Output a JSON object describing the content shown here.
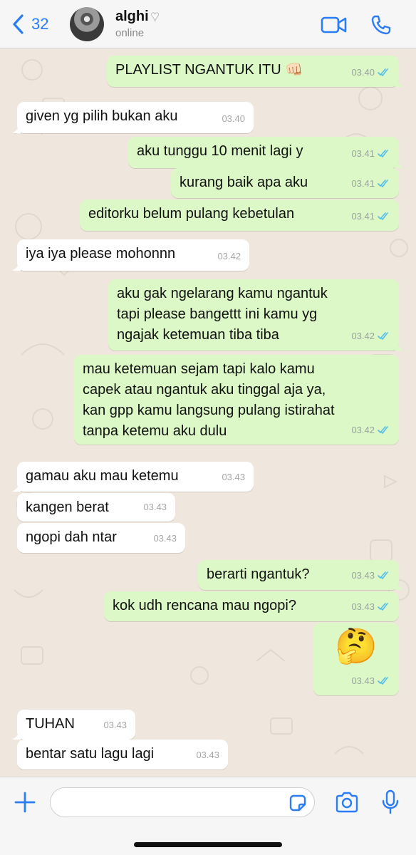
{
  "header": {
    "back_count": "32",
    "contact_name": "alghi",
    "contact_status": "online"
  },
  "messages": [
    {
      "dir": "out",
      "text": "PLAYLIST NGANTUK ITU 👊🏻",
      "time": "03.40"
    },
    {
      "dir": "in",
      "text": "given yg pilih bukan aku",
      "time": "03.40"
    },
    {
      "dir": "out",
      "text": "aku tunggu 10 menit lagi y",
      "time": "03.41"
    },
    {
      "dir": "out",
      "text": "kurang baik apa aku",
      "time": "03.41"
    },
    {
      "dir": "out",
      "text": "editorku belum pulang kebetulan",
      "time": "03.41"
    },
    {
      "dir": "in",
      "text": "iya iya please mohonnn",
      "time": "03.42"
    },
    {
      "dir": "out",
      "text": "aku gak ngelarang kamu ngantuk tapi please bangettt ini kamu yg ngajak ketemuan tiba tiba",
      "time": "03.42"
    },
    {
      "dir": "out",
      "text": "mau ketemuan sejam tapi kalo kamu capek atau ngantuk aku tinggal aja ya, kan gpp kamu langsung pulang istirahat tanpa ketemu aku dulu",
      "time": "03.42"
    },
    {
      "dir": "in",
      "text": "gamau aku mau ketemu",
      "time": "03.43"
    },
    {
      "dir": "in",
      "text": "kangen berat",
      "time": "03.43"
    },
    {
      "dir": "in",
      "text": "ngopi dah ntar",
      "time": "03.43"
    },
    {
      "dir": "out",
      "text": "berarti ngantuk?",
      "time": "03.43"
    },
    {
      "dir": "out",
      "text": "kok udh rencana mau ngopi?",
      "time": "03.43"
    },
    {
      "dir": "out",
      "text": "🤔",
      "time": "03.43"
    },
    {
      "dir": "in",
      "text": "TUHAN",
      "time": "03.43"
    },
    {
      "dir": "in",
      "text": "bentar satu lagu lagi",
      "time": "03.43"
    }
  ],
  "colors": {
    "outgoing_bubble": "#dcf8c6",
    "incoming_bubble": "#ffffff",
    "accent": "#2a7df6",
    "read_ticks": "#53bdeb"
  },
  "icons": {
    "header": [
      "back-chevron-icon",
      "video-call-icon",
      "phone-icon"
    ],
    "composer": [
      "plus-icon",
      "sticker-icon",
      "camera-icon",
      "microphone-icon"
    ]
  }
}
